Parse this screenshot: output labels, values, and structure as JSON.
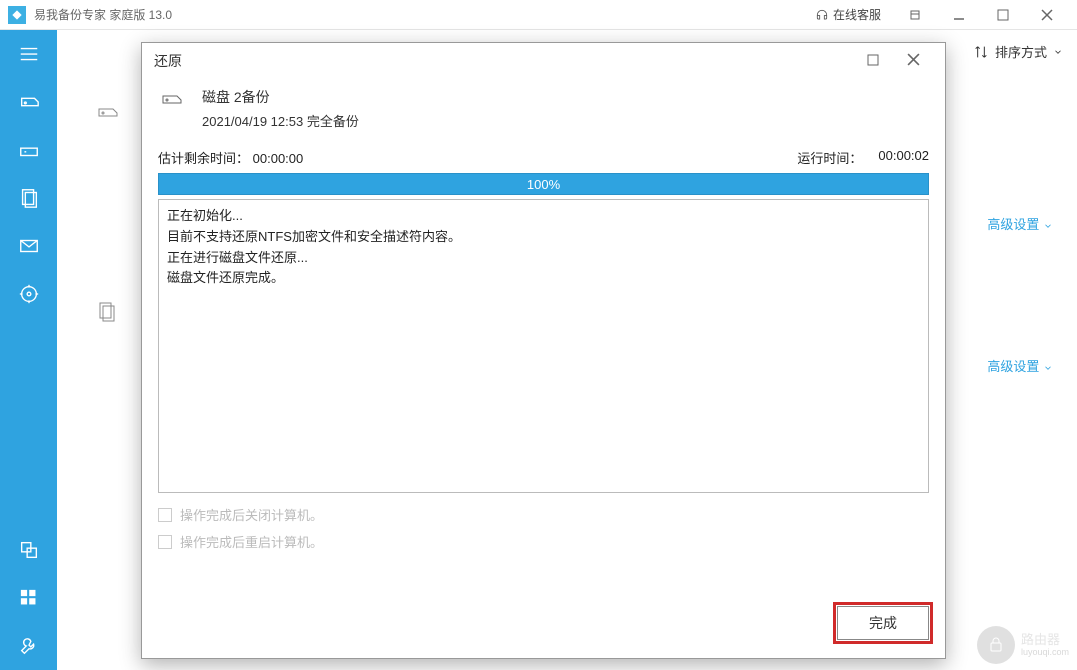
{
  "app": {
    "title": "易我备份专家 家庭版  13.0",
    "support_label": "在线客服"
  },
  "topbar": {
    "sort_label": "排序方式"
  },
  "cards": {
    "advanced_label": "高级设置"
  },
  "dialog": {
    "title": "还原",
    "backup_name": "磁盘 2备份",
    "backup_meta": "2021/04/19 12:53 完全备份",
    "est_label": "估计剩余时间：",
    "est_value": "00:00:00",
    "run_label": "运行时间：",
    "run_value": "00:00:02",
    "progress_text": "100%",
    "log_lines": [
      "正在初始化...",
      "目前不支持还原NTFS加密文件和安全描述符内容。",
      "正在进行磁盘文件还原...",
      "磁盘文件还原完成。"
    ],
    "chk_shutdown": "操作完成后关闭计算机。",
    "chk_restart": "操作完成后重启计算机。",
    "done_label": "完成"
  },
  "watermark": {
    "text": "路由器",
    "sub": "luyouqi.com"
  }
}
